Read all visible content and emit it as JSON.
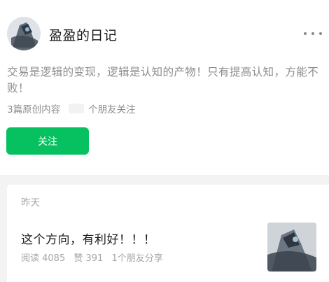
{
  "account": {
    "name": "盈盈的日记",
    "bio": "交易是逻辑的变现，逻辑是认知的产物！只有提高认知，方能不败！",
    "original_count": "3篇原创内容",
    "followers_label": "个朋友关注",
    "follow_label": "关注"
  },
  "feed": {
    "articles": [
      {
        "date": "昨天",
        "title": "这个方向，有利好！！！",
        "reads": "阅读 4085",
        "likes": "赞 391",
        "shares": "1个朋友分享"
      }
    ]
  },
  "colors": {
    "accent": "#07c160",
    "secondary_text": "#8c8c8c",
    "feed_background": "#f3f3f3"
  },
  "icons": {
    "more": "more-dots-icon"
  }
}
